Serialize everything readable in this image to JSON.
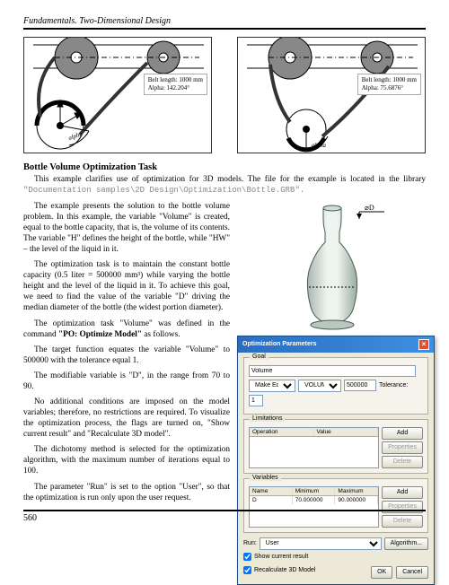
{
  "header": {
    "title": "Fundamentals. Two-Dimensional Design"
  },
  "belt_diagrams": [
    {
      "length": "Belt length: 1000 mm",
      "alpha": "Alpha: 142.204°",
      "alpha_word": "alpha"
    },
    {
      "length": "Belt length: 1000 mm",
      "alpha": "Alpha: 75.6876°",
      "alpha_word": "alpha"
    }
  ],
  "section": {
    "title": "Bottle Volume Optimization Task",
    "intro": "This example clarifies use of optimization for 3D models. The file for the example is located in the library",
    "path": "\"Documentation samples\\2D Design\\Optimization\\Bottle.GRB\".",
    "p1": "The example presents the solution to the bottle volume problem. In this example, the variable \"Volume\" is created, equal to the bottle capacity, that is, the volume of its contents. The variable \"H\" defines the height of the bottle, while \"HW\" – the level of the liquid in it.",
    "p2": "The optimization task is to maintain the constant bottle capacity (0.5 liter = 500000 mm³) while varying the bottle height and the level of the liquid in it. To achieve this goal, we need to find the value of the variable \"D\" driving the median diameter of the bottle (the widest portion diameter).",
    "p3a": "The optimization task \"Volume\" was defined in the command ",
    "p3b": "\"PO: Optimize Model\"",
    "p3c": " as follows.",
    "p4": "The target function equates the variable \"Volume\" to 500000 with the tolerance equal 1.",
    "p5": "The modifiable variable is \"D\", in the range from 70 to 90.",
    "p6": "No additional conditions are imposed on the model variables; therefore, no restrictions are required. To visualize the optimization process, the flags are turned on, \"Show current result\" and \"Recalculate 3D model\".",
    "p7": "The dichotomy method is selected for the optimization algorithm, with the maximum number of iterations equal to 100.",
    "p8": "The parameter \"Run\" is set to the option \"User\", so that the optimization is run only upon the user request."
  },
  "bottle": {
    "dim_label": "⌀D"
  },
  "dialog": {
    "title": "Optimization Parameters",
    "goal": {
      "label": "Goal",
      "name_value": "Volume",
      "make_label": "Make Equal",
      "var_option": "VOLUME",
      "target_value": "500000",
      "tol_label": "Tolerance:",
      "tol_value": "1"
    },
    "limitations": {
      "label": "Limitations",
      "cols": [
        "Operation",
        "Value"
      ],
      "buttons": {
        "add": "Add",
        "props": "Properties",
        "del": "Delete"
      }
    },
    "variables": {
      "label": "Variables",
      "cols": [
        "Name",
        "Minimum",
        "Maximum"
      ],
      "row": [
        "D",
        "70.000000",
        "90.000000"
      ],
      "buttons": {
        "add": "Add",
        "props": "Properties",
        "del": "Delete"
      }
    },
    "run": {
      "label": "Run:",
      "option": "User",
      "algo": "Algorithm..."
    },
    "checks": {
      "show": "Show current result",
      "recalc": "Recalculate 3D Model"
    },
    "footer": {
      "ok": "OK",
      "cancel": "Cancel"
    }
  },
  "page_number": "560"
}
